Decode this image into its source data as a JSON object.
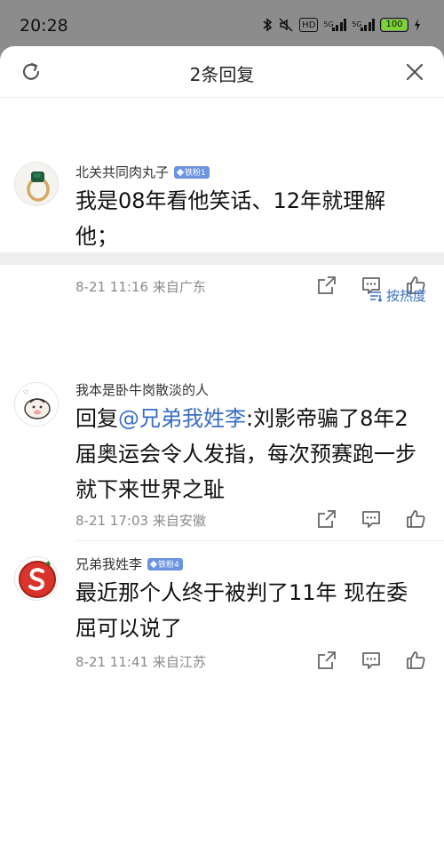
{
  "status_bar": {
    "time": "20:28",
    "network_hd": "HD",
    "sig1_label": "5G",
    "sig2_label": "5G",
    "battery": "100"
  },
  "header": {
    "title": "2条回复",
    "icons": {
      "refresh": "refresh-icon",
      "close": "close-icon"
    }
  },
  "main_comment": {
    "username": "北关共同肉丸子",
    "badge": "铁粉1",
    "text": "我是08年看他笑话、12年就理解他；",
    "time": "8-21 11:16",
    "location": "来自广东"
  },
  "sort": {
    "label": "按热度",
    "icon": "sort-icon"
  },
  "replies": [
    {
      "username": "我本是卧牛岗散淡的人",
      "badge": "",
      "prefix": "回复",
      "mention": "@兄弟我姓李",
      "text": ":刘影帝骗了8年2届奥运会令人发指，每次预赛跑一步就下来世界之耻",
      "time": "8-21 17:03",
      "location": "来自安徽"
    },
    {
      "username": "兄弟我姓李",
      "badge": "铁粉4",
      "text": "最近那个人终于被判了11年 现在委屈可以说了",
      "time": "8-21 11:41",
      "location": "来自江苏"
    }
  ],
  "action_icons": [
    "share-icon",
    "comment-icon",
    "like-icon"
  ],
  "colors": {
    "accent": "#3a6fc4",
    "badge": "#6b93e0",
    "battery": "#7cd336"
  }
}
